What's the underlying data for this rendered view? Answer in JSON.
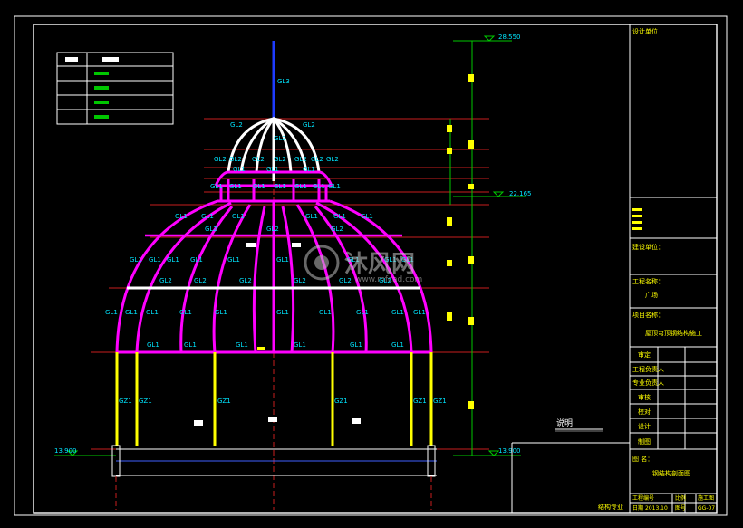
{
  "colors": {
    "background": "#000000",
    "frame": "#ffffff",
    "dome_member": "#ff00ff",
    "crown_member": "#ffffff",
    "mast": "#1e3cff",
    "column": "#ffff00",
    "label_cyan": "#00e5ff",
    "level_line": "#c81e1e",
    "dim_green": "#00c800",
    "text_yellow": "#ffff00"
  },
  "levels": {
    "top": "28.550",
    "ring": "22.165",
    "base_left": "13.900",
    "base_right": "13.900"
  },
  "member_labels": {
    "mast": "GL3",
    "gl1": "GL1",
    "gl2": "GL2",
    "column": "GZ1"
  },
  "section_label": "说明",
  "watermark": {
    "brand": "沐风网",
    "url": "www.mfcad.com"
  },
  "title_block": {
    "design_unit": "设计单位",
    "building_unit": "建设单位：",
    "project_name_label": "工程名称：",
    "project_name_value": "广场",
    "item_name_label": "项目名称：",
    "item_name_value": "屋顶穹顶钢结构施工",
    "roles": [
      "审定",
      "工程负责人",
      "专业负责人",
      "审核",
      "校对",
      "设计",
      "制图"
    ],
    "drawing_label": "图 名：",
    "drawing_value": "钢结构剖面图",
    "project_no_label": "工程编号",
    "scale_label": "比例",
    "date_label": "日期",
    "date_value": "2013.10",
    "stage_label": "阶段",
    "stage_value": "施工图",
    "sheet_label": "图号",
    "sheet_value": "GG-07"
  },
  "footer_stamp": "结构专业"
}
